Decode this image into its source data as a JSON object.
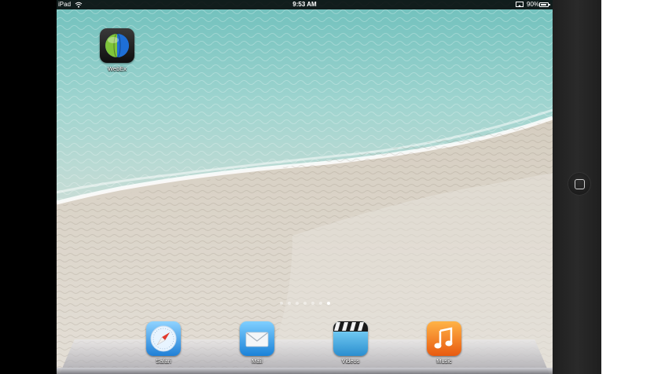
{
  "status_bar": {
    "device_name": "iPad",
    "time": "9:53 AM",
    "battery_percent": "90%",
    "battery_level": 0.9
  },
  "home_screen": {
    "apps": [
      {
        "label": "WebEx",
        "icon": "webex-globe-icon"
      }
    ],
    "page_count": 7,
    "current_page": 7
  },
  "dock": {
    "apps": [
      {
        "label": "Safari",
        "icon": "compass-icon"
      },
      {
        "label": "Mail",
        "icon": "envelope-icon"
      },
      {
        "label": "Videos",
        "icon": "clapperboard-icon"
      },
      {
        "label": "Music",
        "icon": "music-note-icon"
      }
    ]
  },
  "colors": {
    "sea": "#7fc8c4",
    "sand": "#d6d0c5",
    "status_bar": "#000000"
  }
}
